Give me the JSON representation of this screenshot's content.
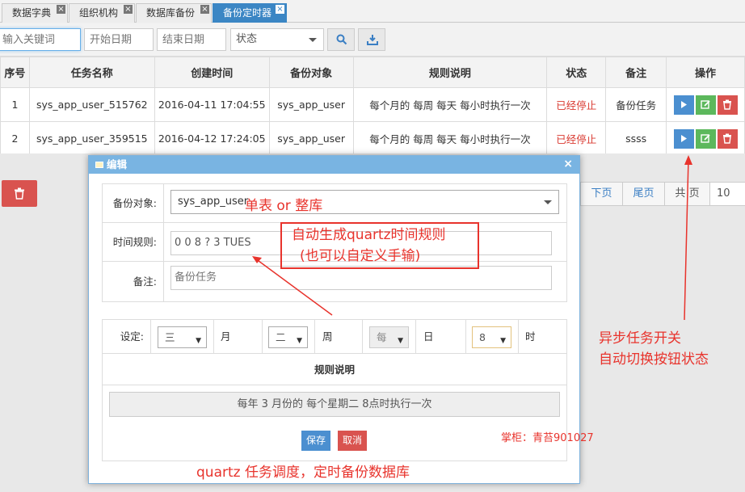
{
  "tabs": [
    {
      "label": "数据字典",
      "active": false
    },
    {
      "label": "组织机构",
      "active": false
    },
    {
      "label": "数据库备份",
      "active": false
    },
    {
      "label": "备份定时器",
      "active": true
    }
  ],
  "toolbar": {
    "keyword_placeholder": "输入关键词",
    "start_date_placeholder": "开始日期",
    "end_date_placeholder": "结束日期",
    "status_select": "状态"
  },
  "table": {
    "columns": [
      "序号",
      "任务名称",
      "创建时间",
      "备份对象",
      "规则说明",
      "状态",
      "备注",
      "操作"
    ],
    "rows": [
      {
        "no": "1",
        "name": "sys_app_user_515762",
        "created": "2016-04-11 17:04:55",
        "target": "sys_app_user",
        "rule": "每个月的 每周 每天 每小时执行一次",
        "status": "已经停止",
        "remark": "备份任务"
      },
      {
        "no": "2",
        "name": "sys_app_user_359515",
        "created": "2016-04-12 17:24:05",
        "target": "sys_app_user",
        "rule": "每个月的 每周 每天 每小时执行一次",
        "status": "已经停止",
        "remark": "ssss"
      }
    ]
  },
  "pager": {
    "next": "下页",
    "last": "尾页",
    "total": "共",
    "page_word": "页",
    "page_size": "10"
  },
  "dialog": {
    "title": "编辑",
    "close": "×",
    "backup_target_label": "备份对象:",
    "backup_target_value": "sys_app_user",
    "time_rule_label": "时间规则:",
    "time_rule_value": "0 0 8 ? 3 TUES",
    "remark_label": "备注:",
    "remark_value": "备份任务",
    "settings": {
      "label": "设定:",
      "month_value": "三",
      "month_unit": "月",
      "week_value": "二",
      "week_unit": "周",
      "day_value": "每",
      "day_unit": "日",
      "hour_value": "8",
      "hour_unit": "时"
    },
    "rule_title": "规则说明",
    "rule_desc": "每年 3 月份的 每个星期二 8点时执行一次",
    "save": "保存",
    "cancel": "取消"
  },
  "annotations": {
    "single_or_all": "单表 or 整库",
    "auto_rule_line1": "自动生成quartz时间规则",
    "auto_rule_line2": "(也可以自定义手输)",
    "async_line1": "异步任务开关",
    "async_line2": "自动切换按钮状态",
    "author": "掌柜：青苔901027",
    "footer": "quartz 任务调度，定时备份数据库"
  },
  "colors": {
    "accent": "#3b86c4",
    "danger": "#d9534f",
    "success": "#5cb85c",
    "annotation": "#e8332c"
  }
}
